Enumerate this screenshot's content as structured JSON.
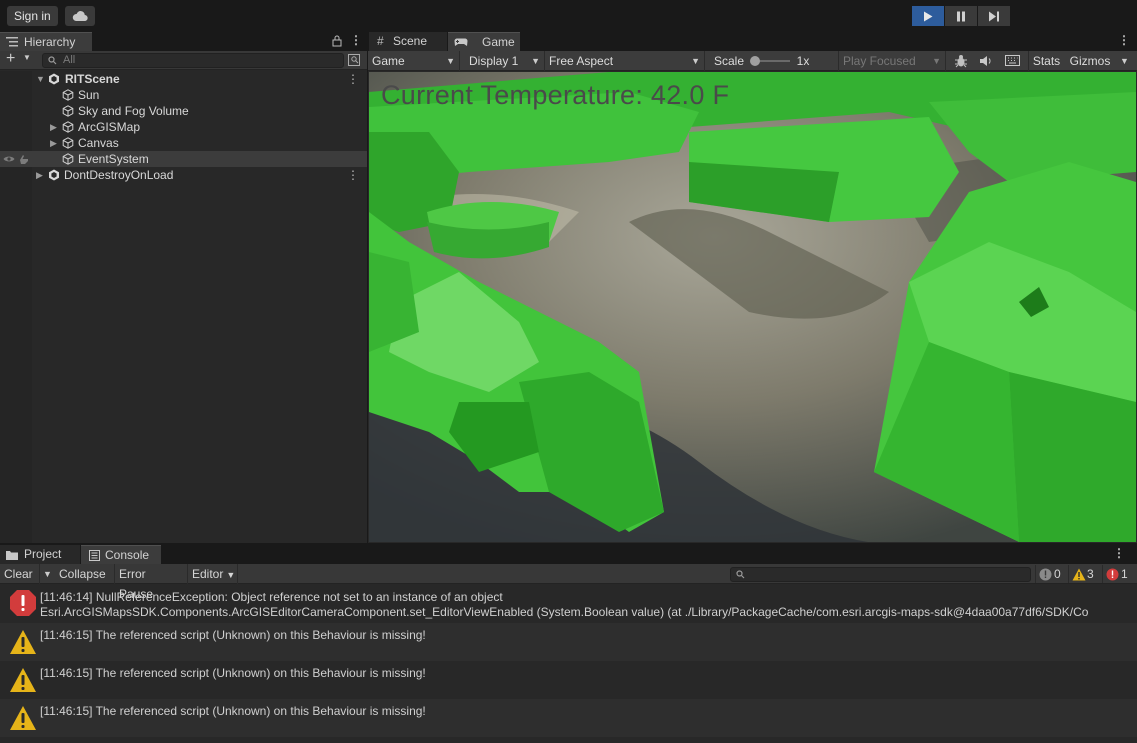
{
  "toolbar": {
    "sign_in": "Sign in",
    "cloud_icon": "cloud-icon",
    "play_icon": "play-icon",
    "pause_icon": "pause-icon",
    "step_icon": "step-icon"
  },
  "hierarchy": {
    "tab_label": "Hierarchy",
    "search_placeholder": "All",
    "items": [
      {
        "label": "RITScene",
        "level": 0,
        "expanded": true,
        "scene": true
      },
      {
        "label": "Sun",
        "level": 1
      },
      {
        "label": "Sky and Fog Volume",
        "level": 1
      },
      {
        "label": "ArcGISMap",
        "level": 1,
        "collapsed": true
      },
      {
        "label": "Canvas",
        "level": 1,
        "collapsed": true
      },
      {
        "label": "EventSystem",
        "level": 1,
        "selected": true
      },
      {
        "label": "DontDestroyOnLoad",
        "level": 0,
        "collapsed": true,
        "scene": true
      }
    ]
  },
  "game": {
    "tabs": [
      {
        "label": "Scene"
      },
      {
        "label": "Game",
        "active": true
      }
    ],
    "mode": "Game",
    "display": "Display 1",
    "aspect": "Free Aspect",
    "scale_label": "Scale",
    "scale_value": "1x",
    "play_mode": "Play Focused",
    "stats": "Stats",
    "gizmos": "Gizmos",
    "hud_text": "Current Temperature: 42.0 F"
  },
  "console": {
    "tabs": [
      {
        "label": "Project"
      },
      {
        "label": "Console",
        "active": true
      }
    ],
    "clear": "Clear",
    "collapse": "Collapse",
    "error_pause": "Error Pause",
    "editor": "Editor",
    "counts": {
      "info": "0",
      "warning": "3",
      "error": "1"
    },
    "entries": [
      {
        "type": "error",
        "line1": "[11:46:14] NullReferenceException: Object reference not set to an instance of an object",
        "line2": "Esri.ArcGISMapsSDK.Components.ArcGISEditorCameraComponent.set_EditorViewEnabled (System.Boolean value) (at ./Library/PackageCache/com.esri.arcgis-maps-sdk@4daa00a77df6/SDK/Co"
      },
      {
        "type": "warning",
        "line1": "[11:46:15] The referenced script (Unknown) on this Behaviour is missing!",
        "line2": ""
      },
      {
        "type": "warning",
        "line1": "[11:46:15] The referenced script (Unknown) on this Behaviour is missing!",
        "line2": ""
      },
      {
        "type": "warning",
        "line1": "[11:46:15] The referenced script (Unknown) on this Behaviour is missing!",
        "line2": ""
      }
    ]
  },
  "colors": {
    "accent_play": "#2d5c9c",
    "error": "#d23c3c",
    "warning": "#e6b419",
    "building_green": "#3fbf3a"
  }
}
